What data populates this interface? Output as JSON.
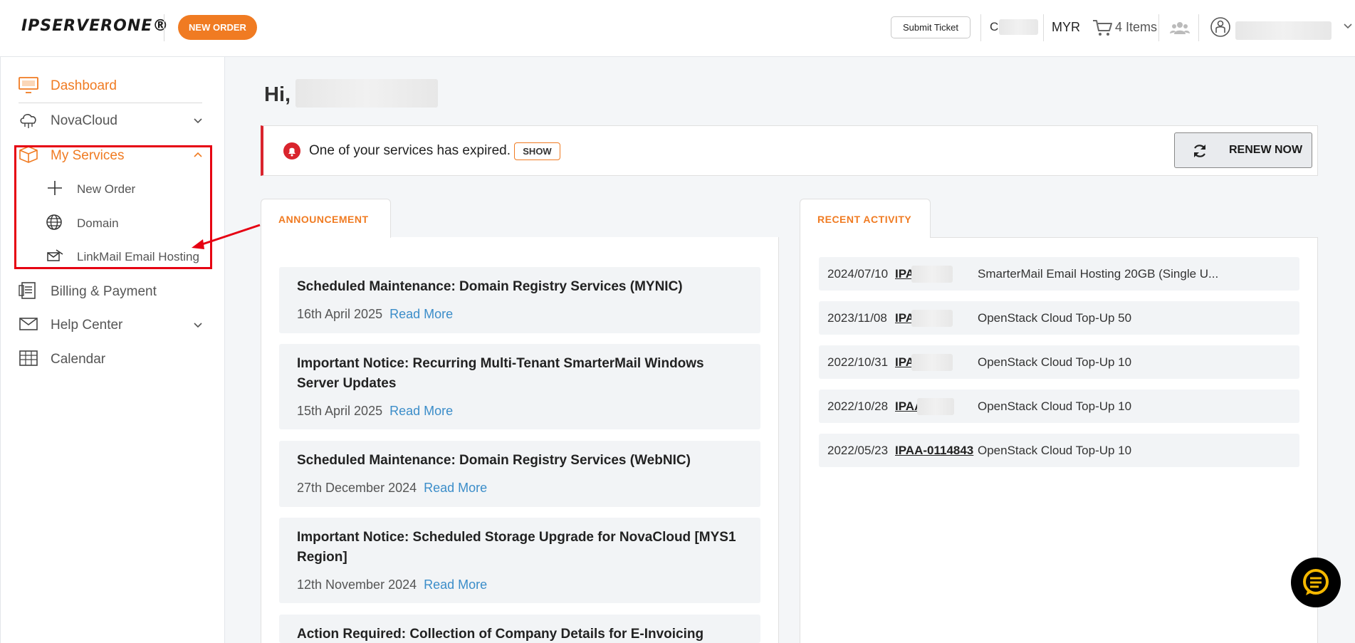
{
  "header": {
    "logo_text": "IPSERVERONE®",
    "new_order_label": "NEW ORDER",
    "submit_ticket_label": "Submit Ticket",
    "account_initial": "C",
    "currency": "MYR",
    "cart_label": "4 Items"
  },
  "sidebar": {
    "dashboard": "Dashboard",
    "novacloud": "NovaCloud",
    "my_services": "My Services",
    "sub": {
      "new_order": "New Order",
      "domain": "Domain",
      "linkmail": "LinkMail Email Hosting"
    },
    "billing": "Billing & Payment",
    "help_center": "Help Center",
    "calendar": "Calendar"
  },
  "main": {
    "greeting": "Hi,",
    "alert": {
      "text": "One of your services has expired.",
      "show_label": "SHOW",
      "renew_label": "RENEW NOW"
    },
    "announcement": {
      "tab_label": "ANNOUNCEMENT",
      "read_more": "Read More",
      "items": [
        {
          "title": "Scheduled Maintenance: Domain Registry Services (MYNIC)",
          "date": "16th April 2025"
        },
        {
          "title": "Important Notice: Recurring Multi-Tenant SmarterMail Windows Server Updates",
          "date": "15th April 2025"
        },
        {
          "title": "Scheduled Maintenance: Domain Registry Services (WebNIC)",
          "date": "27th December 2024"
        },
        {
          "title": "Important Notice: Scheduled Storage Upgrade for NovaCloud [MYS1 Region]",
          "date": "12th November 2024"
        },
        {
          "title": "Action Required: Collection of Company Details for E-Invoicing Initiative",
          "date": ""
        }
      ]
    },
    "activity": {
      "tab_label": "RECENT ACTIVITY",
      "rows": [
        {
          "date": "2024/07/10",
          "id": "IPAA-0",
          "desc": "SmarterMail Email Hosting 20GB (Single U..."
        },
        {
          "date": "2023/11/08",
          "id": "IPAA-0",
          "desc": "OpenStack Cloud Top-Up 50"
        },
        {
          "date": "2022/10/31",
          "id": "IPAA-0",
          "desc": "OpenStack Cloud Top-Up 10"
        },
        {
          "date": "2022/10/28",
          "id": "IPAA-01",
          "desc": "OpenStack Cloud Top-Up 10"
        },
        {
          "date": "2022/05/23",
          "id": "IPAA-0114843",
          "desc": "OpenStack Cloud Top-Up 10"
        }
      ]
    }
  },
  "colors": {
    "accent": "#f07b22",
    "alert_red": "#d9242d",
    "highlight_red": "#e60012",
    "link_blue": "#3b8dc9"
  }
}
